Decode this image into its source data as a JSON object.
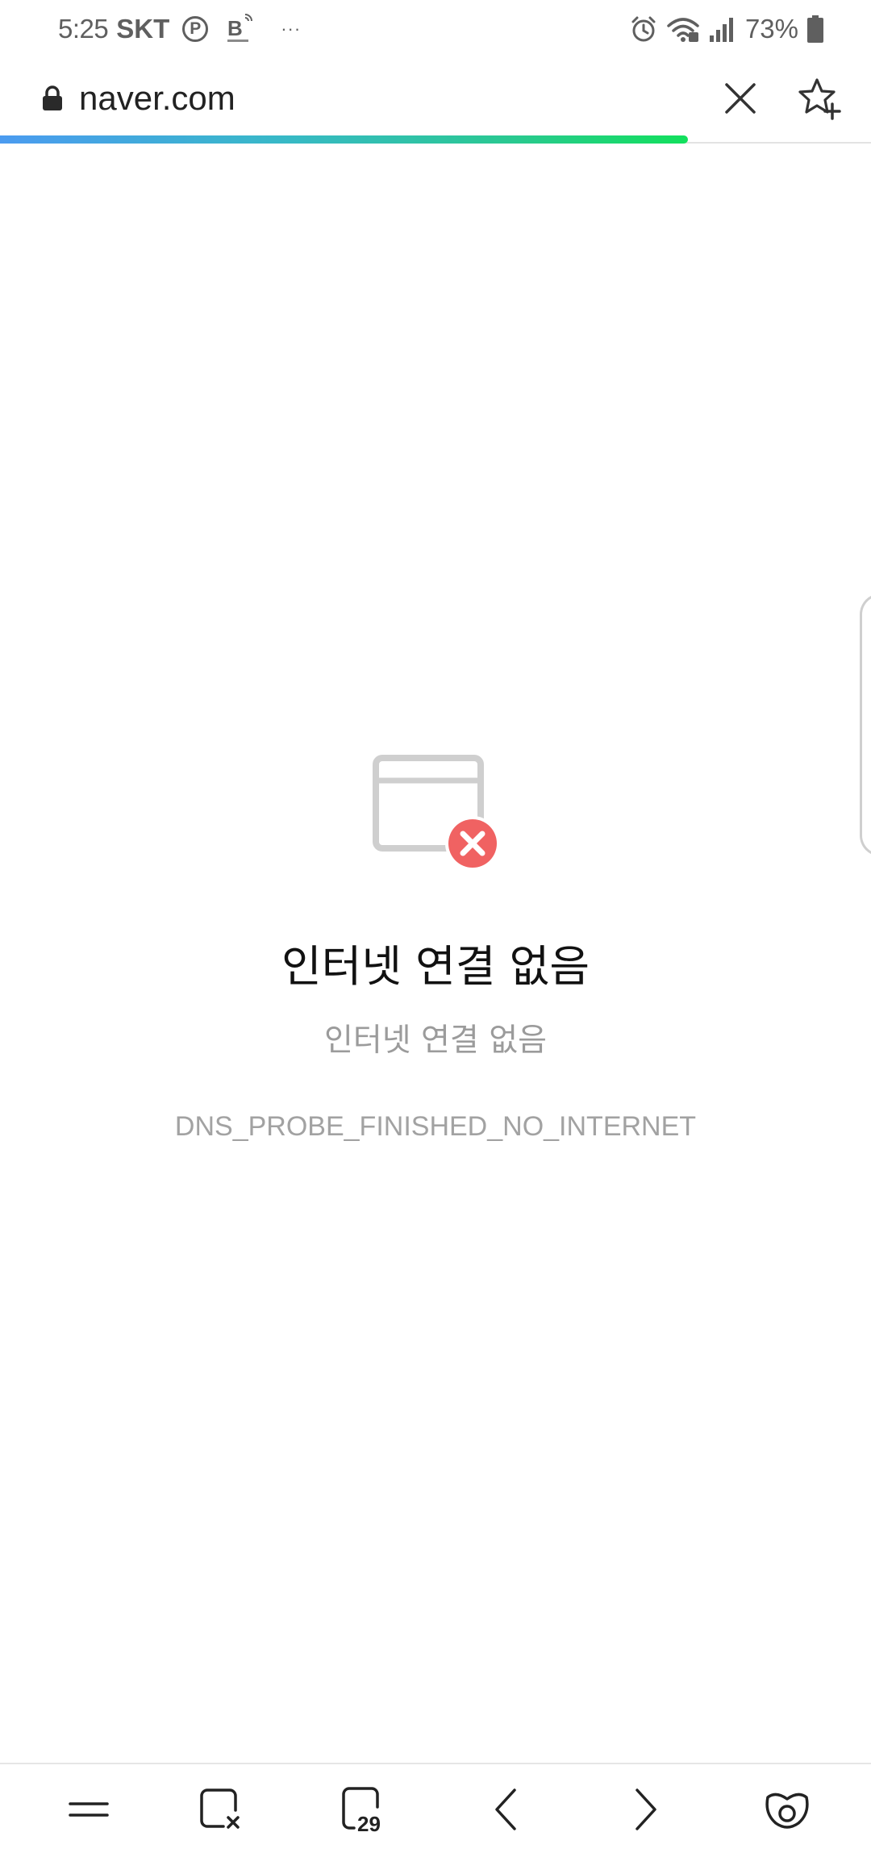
{
  "status_bar": {
    "time": "5:25",
    "carrier": "SKT",
    "p_badge": "P",
    "more": "···",
    "battery_percent": "73%"
  },
  "url_bar": {
    "url": "naver.com",
    "load_progress": 0.79
  },
  "error": {
    "title": "인터넷 연결 없음",
    "subtitle": "인터넷 연결 없음",
    "code": "DNS_PROBE_FINISHED_NO_INTERNET"
  },
  "toolbar": {
    "tab_count": "29",
    "icons": [
      "menu-icon",
      "close-tabs-icon",
      "tabs-icon",
      "back-icon",
      "forward-icon",
      "whale-icon"
    ]
  },
  "colors": {
    "error_badge": "#f06262",
    "icon_gray": "#cfcfcf",
    "progress_start": "#4b9bf0",
    "progress_end": "#12e05c"
  }
}
